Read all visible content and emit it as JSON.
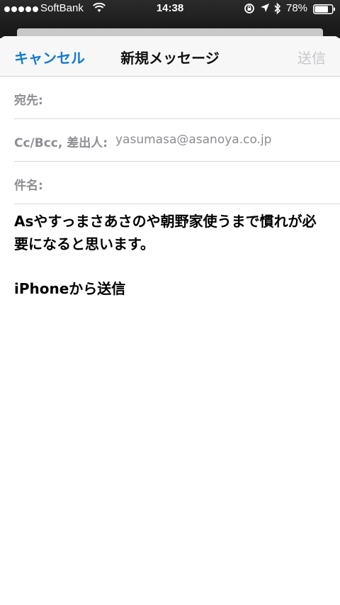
{
  "status_bar": {
    "carrier": "SoftBank",
    "time": "14:38",
    "battery_percent": "78%",
    "icons": [
      "signal-dots",
      "wifi-icon",
      "rotation-lock-icon",
      "location-icon",
      "bluetooth-icon",
      "battery-icon"
    ]
  },
  "nav": {
    "cancel_label": "キャンセル",
    "title": "新規メッセージ",
    "send_label": "送信"
  },
  "fields": {
    "to_label": "宛先:",
    "to_value": "",
    "cc_label": "Cc/Bcc, 差出人:",
    "from_value": "yasumasa@asanoya.co.jp",
    "subject_label": "件名:",
    "subject_value": ""
  },
  "body": {
    "text": "Asやすっまさあさのや朝野家使うまで慣れが必要になると思います。",
    "signature": "iPhoneから送信"
  },
  "colors": {
    "accent": "#1479d4",
    "disabled": "#c7c7cc",
    "label": "#8e8e93"
  }
}
